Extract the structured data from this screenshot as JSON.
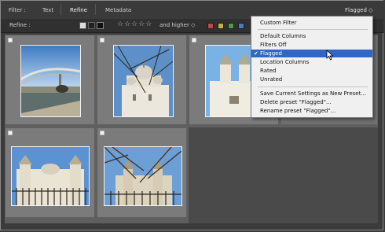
{
  "filter_bar": {
    "label": "Filter :",
    "tabs": [
      "Text",
      "Refine",
      "Metadata"
    ],
    "preset": "Flagged ◇"
  },
  "refine_bar": {
    "label": "Refine :",
    "stars": "☆☆☆☆☆",
    "higher": "and higher ◇",
    "color_labels": [
      "#c0464a",
      "#c8b13a",
      "#4f9a4c",
      "#4a79c5"
    ]
  },
  "menu": {
    "items": [
      {
        "label": "Custom Filter"
      },
      {
        "label": "Default Columns"
      },
      {
        "label": "Filters Off"
      },
      {
        "label": "Flagged",
        "checked": true
      },
      {
        "label": "Location Columns"
      },
      {
        "label": "Rated"
      },
      {
        "label": "Unrated"
      },
      {
        "label": "Save Current Settings as New Preset..."
      },
      {
        "label": "Delete preset \"Flagged\"..."
      },
      {
        "label": "Rename preset \"Flagged\"..."
      }
    ],
    "checkmark": "✔"
  },
  "thumbnails": [
    {
      "subject": "footbridge-over-river"
    },
    {
      "subject": "domed-church-through-branches"
    },
    {
      "subject": "white-church-towers"
    },
    {
      "subject": "church-with-fence"
    },
    {
      "subject": "church-behind-trees-and-fence"
    }
  ]
}
